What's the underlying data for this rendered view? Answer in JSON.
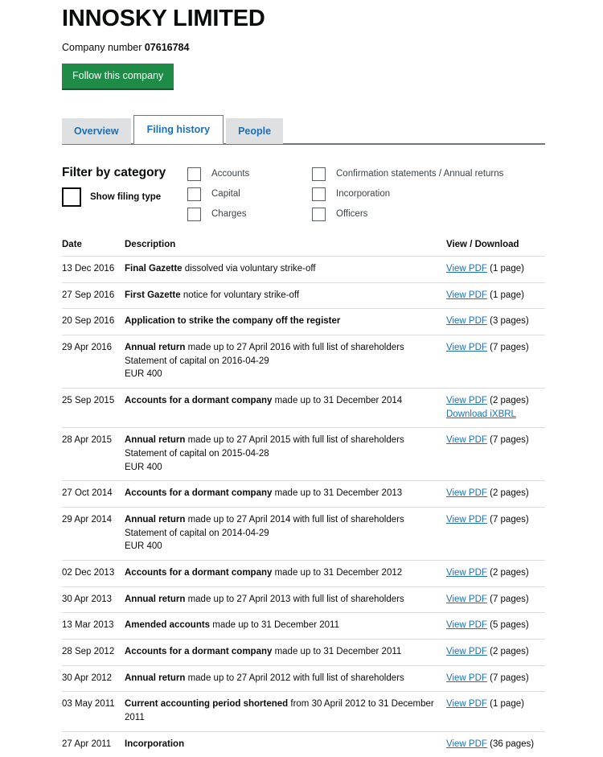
{
  "company": {
    "name": "INNOSKY LIMITED",
    "number_label": "Company number",
    "number": "07616784",
    "follow_button": "Follow this company"
  },
  "tabs": [
    {
      "label": "Overview",
      "active": false
    },
    {
      "label": "Filing history",
      "active": true
    },
    {
      "label": "People",
      "active": false
    }
  ],
  "filter": {
    "title": "Filter by category",
    "show_filing_type_label": "Show filing type",
    "categories_col1": [
      "Accounts",
      "Capital",
      "Charges"
    ],
    "categories_col2": [
      "Confirmation statements / Annual returns",
      "Incorporation",
      "Officers"
    ]
  },
  "table": {
    "headers": {
      "date": "Date",
      "description": "Description",
      "view": "View / Download"
    },
    "view_pdf_label": "View PDF",
    "download_ixbrl_label": "Download iXBRL",
    "rows": [
      {
        "date": "13 Dec 2016",
        "desc_bold": "Final Gazette",
        "desc_rest": " dissolved via voluntary strike-off",
        "sub": [],
        "pages": "(1 page)",
        "ixbrl": false
      },
      {
        "date": "27 Sep 2016",
        "desc_bold": "First Gazette",
        "desc_rest": " notice for voluntary strike-off",
        "sub": [],
        "pages": "(1 page)",
        "ixbrl": false
      },
      {
        "date": "20 Sep 2016",
        "desc_bold": "Application to strike the company off the register",
        "desc_rest": "",
        "sub": [],
        "pages": "(3 pages)",
        "ixbrl": false
      },
      {
        "date": "29 Apr 2016",
        "desc_bold": "Annual return",
        "desc_rest": " made up to 27 April 2016 with full list of shareholders",
        "sub": [
          "Statement of capital on 2016-04-29",
          "EUR 400"
        ],
        "pages": "(7 pages)",
        "ixbrl": false
      },
      {
        "date": "25 Sep 2015",
        "desc_bold": "Accounts for a dormant company",
        "desc_rest": " made up to 31 December 2014",
        "sub": [],
        "pages": "(2 pages)",
        "ixbrl": true
      },
      {
        "date": "28 Apr 2015",
        "desc_bold": "Annual return",
        "desc_rest": " made up to 27 April 2015 with full list of shareholders",
        "sub": [
          "Statement of capital on 2015-04-28",
          "EUR 400"
        ],
        "pages": "(7 pages)",
        "ixbrl": false
      },
      {
        "date": "27 Oct 2014",
        "desc_bold": "Accounts for a dormant company",
        "desc_rest": " made up to 31 December 2013",
        "sub": [],
        "pages": "(2 pages)",
        "ixbrl": false
      },
      {
        "date": "29 Apr 2014",
        "desc_bold": "Annual return",
        "desc_rest": " made up to 27 April 2014 with full list of shareholders",
        "sub": [
          "Statement of capital on 2014-04-29",
          "EUR 400"
        ],
        "pages": "(7 pages)",
        "ixbrl": false
      },
      {
        "date": "02 Dec 2013",
        "desc_bold": "Accounts for a dormant company",
        "desc_rest": " made up to 31 December 2012",
        "sub": [],
        "pages": "(2 pages)",
        "ixbrl": false
      },
      {
        "date": "30 Apr 2013",
        "desc_bold": "Annual return",
        "desc_rest": " made up to 27 April 2013 with full list of shareholders",
        "sub": [],
        "pages": "(7 pages)",
        "ixbrl": false
      },
      {
        "date": "13 Mar 2013",
        "desc_bold": "Amended accounts",
        "desc_rest": " made up to 31 December 2011",
        "sub": [],
        "pages": "(5 pages)",
        "ixbrl": false
      },
      {
        "date": "28 Sep 2012",
        "desc_bold": "Accounts for a dormant company",
        "desc_rest": " made up to 31 December 2011",
        "sub": [],
        "pages": "(2 pages)",
        "ixbrl": false
      },
      {
        "date": "30 Apr 2012",
        "desc_bold": "Annual return",
        "desc_rest": " made up to 27 April 2012 with full list of shareholders",
        "sub": [],
        "pages": "(7 pages)",
        "ixbrl": false
      },
      {
        "date": "03 May 2011",
        "desc_bold": "Current accounting period shortened",
        "desc_rest": " from 30 April 2012 to 31 December 2011",
        "sub": [],
        "pages": "(1 page)",
        "ixbrl": false
      },
      {
        "date": "27 Apr 2011",
        "desc_bold": "Incorporation",
        "desc_rest": "",
        "sub": [],
        "pages": "(36 pages)",
        "ixbrl": false
      }
    ]
  },
  "colors": {
    "brand_green": "#1e8c47",
    "link_blue": "#1d70b8",
    "tab_inactive_bg": "#dee0e2"
  }
}
